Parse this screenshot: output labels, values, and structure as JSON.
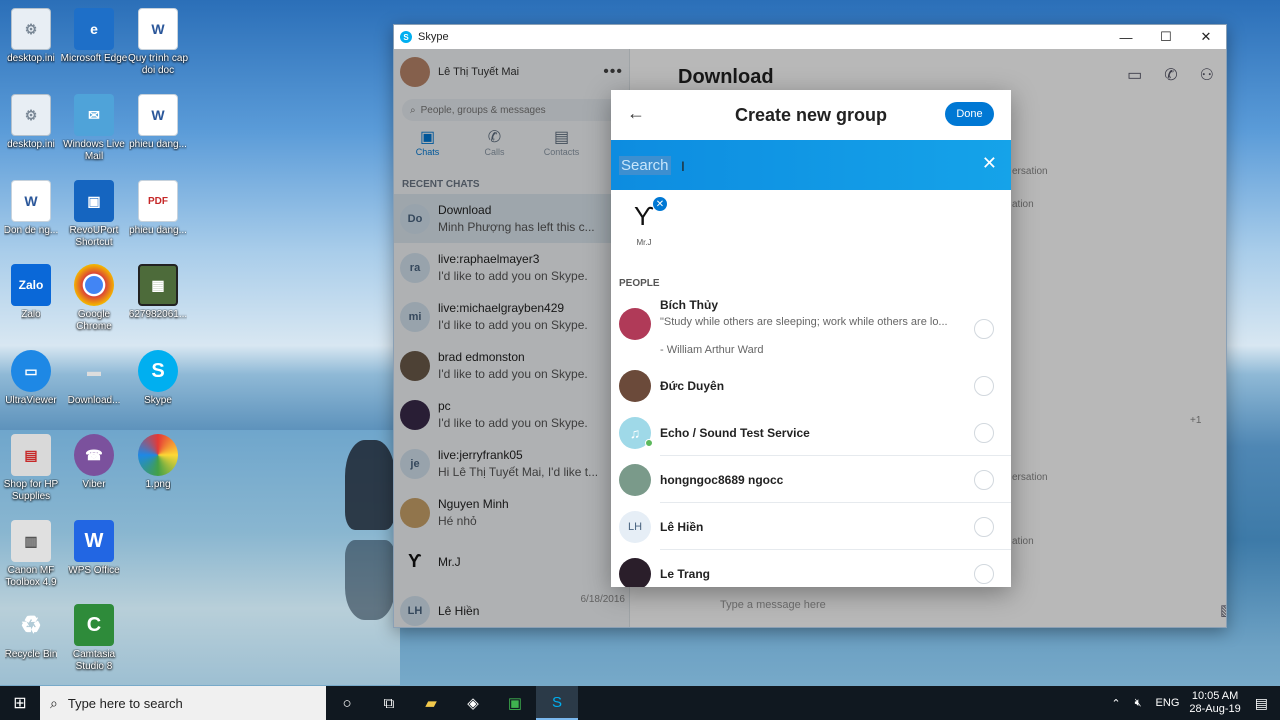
{
  "desktop": {
    "icons": [
      {
        "label": "desktop.ini",
        "glyph": "⚙"
      },
      {
        "label": "Microsoft Edge",
        "glyph": "e"
      },
      {
        "label": "Quy trình cap doi doc",
        "glyph": "W"
      },
      {
        "label": "desktop.ini",
        "glyph": "⚙"
      },
      {
        "label": "Windows Live Mail",
        "glyph": "✉"
      },
      {
        "label": "phieu dang...",
        "glyph": "W"
      },
      {
        "label": "Don de ng...",
        "glyph": "W"
      },
      {
        "label": "RevoUPort Shortcut",
        "glyph": "▣"
      },
      {
        "label": "phieu dang...",
        "glyph": "PDF"
      },
      {
        "label": "Zalo",
        "glyph": "Zalo"
      },
      {
        "label": "Google Chrome",
        "glyph": "◉"
      },
      {
        "label": "627982061...",
        "glyph": "▦"
      },
      {
        "label": "UltraViewer",
        "glyph": "▭"
      },
      {
        "label": "Download...",
        "glyph": "▬"
      },
      {
        "label": "Skype",
        "glyph": "S"
      },
      {
        "label": "Shop for HP Supplies",
        "glyph": "▤"
      },
      {
        "label": "Viber",
        "glyph": "☎"
      },
      {
        "label": "1.png",
        "glyph": "●"
      },
      {
        "label": "Canon MF Toolbox 4.9",
        "glyph": "▥"
      },
      {
        "label": "WPS Office",
        "glyph": "W"
      },
      {
        "label": "Recycle Bin",
        "glyph": "♻"
      },
      {
        "label": "Camtasia Studio 8",
        "glyph": "C"
      }
    ]
  },
  "skype": {
    "window_title": "Skype",
    "controls": {
      "minimize": "—",
      "maximize": "☐",
      "close": "✕"
    },
    "profile_name": "Lê Thị Tuyết Mai",
    "more_glyph": "•••",
    "search_placeholder": "People, groups & messages",
    "tabs": [
      {
        "label": "Chats",
        "glyph": "▣"
      },
      {
        "label": "Calls",
        "glyph": "✆"
      },
      {
        "label": "Contacts",
        "glyph": "▤"
      }
    ],
    "recent_chats_label": "RECENT CHATS",
    "chats": [
      {
        "title": "Download",
        "preview": "Minh Phượng has left this c...",
        "date": "",
        "initials": "Do"
      },
      {
        "title": "live:raphaelmayer3",
        "preview": "I'd like to add you on Skype.",
        "date": "",
        "initials": "ra"
      },
      {
        "title": "live:michaelgrayben429",
        "preview": "I'd like to add you on Skype.",
        "date": "4/",
        "initials": "mi"
      },
      {
        "title": "brad edmonston",
        "preview": "I'd like to add you on Skype.",
        "date": "2/",
        "initials": ""
      },
      {
        "title": "pc",
        "preview": "I'd like to add you on Skype.",
        "date": "",
        "initials": ""
      },
      {
        "title": "live:jerryfrank05",
        "preview": "Hi Lê Thị Tuyết Mai, I'd like t...",
        "date": "",
        "initials": "je"
      },
      {
        "title": "Nguyen Minh",
        "preview": "Hé nhỏ",
        "date": "8/",
        "initials": ""
      },
      {
        "title": "Mr.J",
        "preview": "",
        "date": "",
        "initials": ""
      },
      {
        "title": "Lê Hiền",
        "preview": "",
        "date": "6/18/2016",
        "initials": "LH"
      }
    ],
    "conversation_title": "Download",
    "header_icons": [
      "video-icon",
      "call-icon",
      "add-contact-icon"
    ],
    "faint_texts": [
      "ersation",
      "ation",
      "ersation",
      "ation"
    ],
    "participants_more": "+1",
    "message_placeholder": "Type a message here"
  },
  "modal": {
    "title": "Create new group",
    "back_glyph": "←",
    "done_label": "Done",
    "search_placeholder": "Search",
    "clear_glyph": "✕",
    "selected": [
      {
        "name": "Mr.J",
        "remove_glyph": "✕"
      }
    ],
    "people_label": "PEOPLE",
    "people": [
      {
        "name": "Bích  Thủy",
        "mood": "\"Study while others are sleeping; work while others are lo...",
        "author": "- William Arthur Ward",
        "avatar_color": "#b03a58",
        "online": false
      },
      {
        "name": "Đức Duyên",
        "mood": "",
        "author": "",
        "avatar_color": "#6b4a3a",
        "online": false
      },
      {
        "name": "Echo / Sound Test Service",
        "mood": "",
        "author": "",
        "avatar_color": "#9fd9e8",
        "online": true
      },
      {
        "name": "hongngoc8689 ngocc",
        "mood": "",
        "author": "",
        "avatar_color": "#7a9a8a",
        "online": false
      },
      {
        "name": "Lê Hiền",
        "mood": "",
        "author": "",
        "avatar_color": "#e6eef6",
        "initials": "LH",
        "online": false
      },
      {
        "name": "Le Trang",
        "mood": "",
        "author": "",
        "avatar_color": "#2a1e2a",
        "online": false
      }
    ]
  },
  "taskbar": {
    "search_text": "Type here to search",
    "language": "ENG",
    "time": "10:05 AM",
    "date": "28-Aug-19"
  },
  "colors": {
    "accent": "#0078d4",
    "search_bar": "#15a3e9",
    "taskbar": "#101820"
  }
}
